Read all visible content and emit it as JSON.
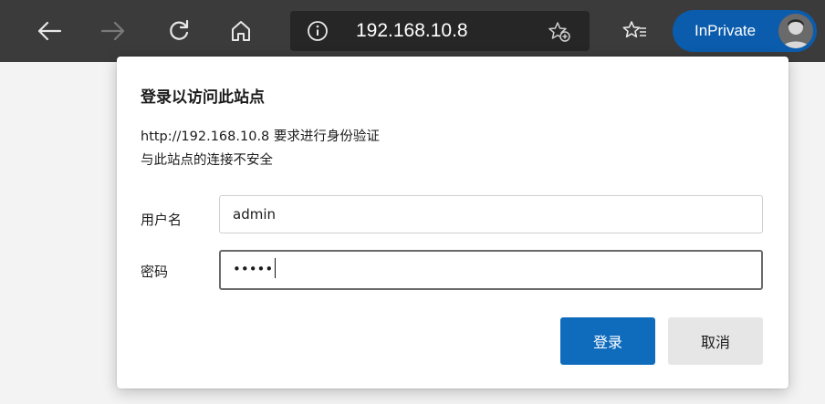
{
  "toolbar": {
    "address": "192.168.10.8",
    "inprivate_label": "InPrivate",
    "icons": [
      "back-icon",
      "forward-icon",
      "refresh-icon",
      "home-icon",
      "info-icon",
      "add-favorite-icon",
      "favorites-icon",
      "profile-avatar"
    ]
  },
  "dialog": {
    "title": "登录以访问此站点",
    "line1": "http://192.168.10.8 要求进行身份验证",
    "line2": "与此站点的连接不安全",
    "username_label": "用户名",
    "username_value": "admin",
    "password_label": "密码",
    "password_value": "•••••",
    "login_label": "登录",
    "cancel_label": "取消"
  },
  "colors": {
    "toolbar_bg": "#3b3b3b",
    "inprivate_bg": "#0b5cad",
    "primary_button": "#0f6cbd"
  }
}
